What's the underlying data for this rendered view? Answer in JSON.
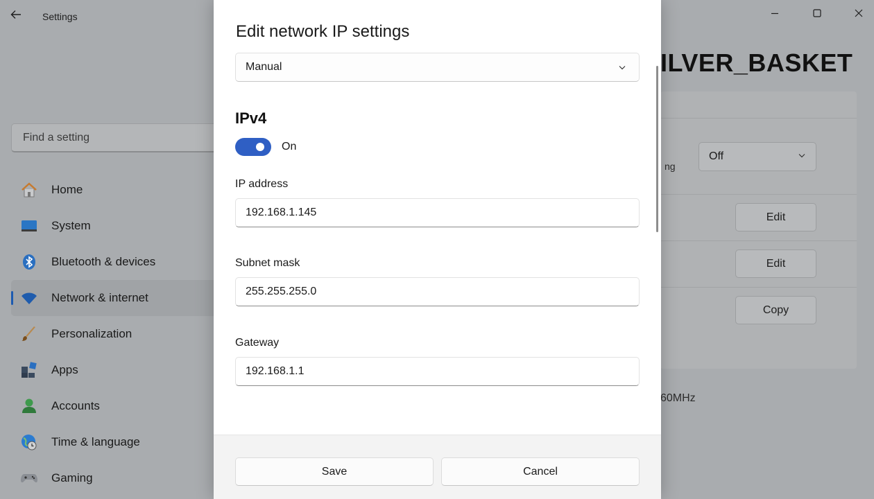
{
  "window": {
    "title": "Settings",
    "back_icon": "back-arrow-icon",
    "minimize_icon": "minimize-icon",
    "maximize_icon": "maximize-icon",
    "close_icon": "close-icon"
  },
  "sidebar": {
    "search_placeholder": "Find a setting",
    "items": [
      {
        "label": "Home",
        "icon": "home-icon",
        "active": false
      },
      {
        "label": "System",
        "icon": "system-icon",
        "active": false
      },
      {
        "label": "Bluetooth & devices",
        "icon": "bluetooth-icon",
        "active": false
      },
      {
        "label": "Network & internet",
        "icon": "wifi-icon",
        "active": true
      },
      {
        "label": "Personalization",
        "icon": "brush-icon",
        "active": false
      },
      {
        "label": "Apps",
        "icon": "apps-icon",
        "active": false
      },
      {
        "label": "Accounts",
        "icon": "person-icon",
        "active": false
      },
      {
        "label": "Time & language",
        "icon": "globe-clock-icon",
        "active": false
      },
      {
        "label": "Gaming",
        "icon": "gamepad-icon",
        "active": false
      }
    ]
  },
  "background_page": {
    "heading_fragment": "ILVER_BASKET",
    "row_fragment": "ng",
    "select_value": "Off",
    "edit_button_1": "Edit",
    "edit_button_2": "Edit",
    "copy_button": "Copy",
    "frequency_fragment": "60MHz"
  },
  "dialog": {
    "title": "Edit network IP settings",
    "mode_value": "Manual",
    "section_title": "IPv4",
    "toggle_state": "On",
    "toggle_on": true,
    "fields": [
      {
        "label": "IP address",
        "value": "192.168.1.145"
      },
      {
        "label": "Subnet mask",
        "value": "255.255.255.0"
      },
      {
        "label": "Gateway",
        "value": "192.168.1.1"
      }
    ],
    "save_label": "Save",
    "cancel_label": "Cancel"
  },
  "colors": {
    "accent": "#2f5fc4",
    "overlay": "#a9acaf",
    "dialog_bg": "#ffffff"
  }
}
